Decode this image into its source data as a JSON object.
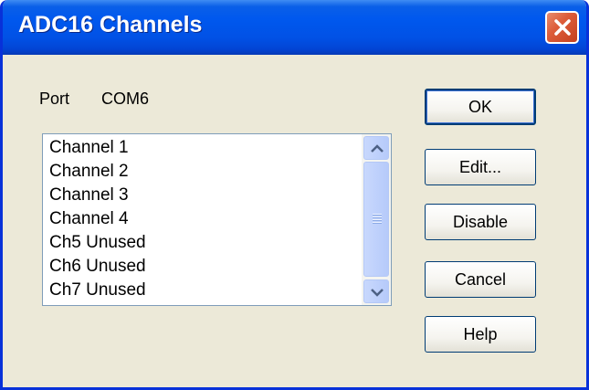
{
  "window": {
    "title": "ADC16 Channels"
  },
  "port": {
    "label": "Port",
    "value": "COM6"
  },
  "channels": [
    "Channel 1",
    "Channel 2",
    "Channel 3",
    "Channel 4",
    "Ch5 Unused",
    "Ch6 Unused",
    "Ch7 Unused"
  ],
  "buttons": {
    "ok": "OK",
    "edit": "Edit...",
    "disable": "Disable",
    "cancel": "Cancel",
    "help": "Help"
  },
  "icons": {
    "close": "close-icon",
    "scroll_up": "chevron-up-icon",
    "scroll_down": "chevron-down-icon",
    "grip": "scroll-grip-icon"
  },
  "colors": {
    "titlebar": "#0058ee",
    "close": "#dd5d3a",
    "dialog_bg": "#ece9d8"
  }
}
